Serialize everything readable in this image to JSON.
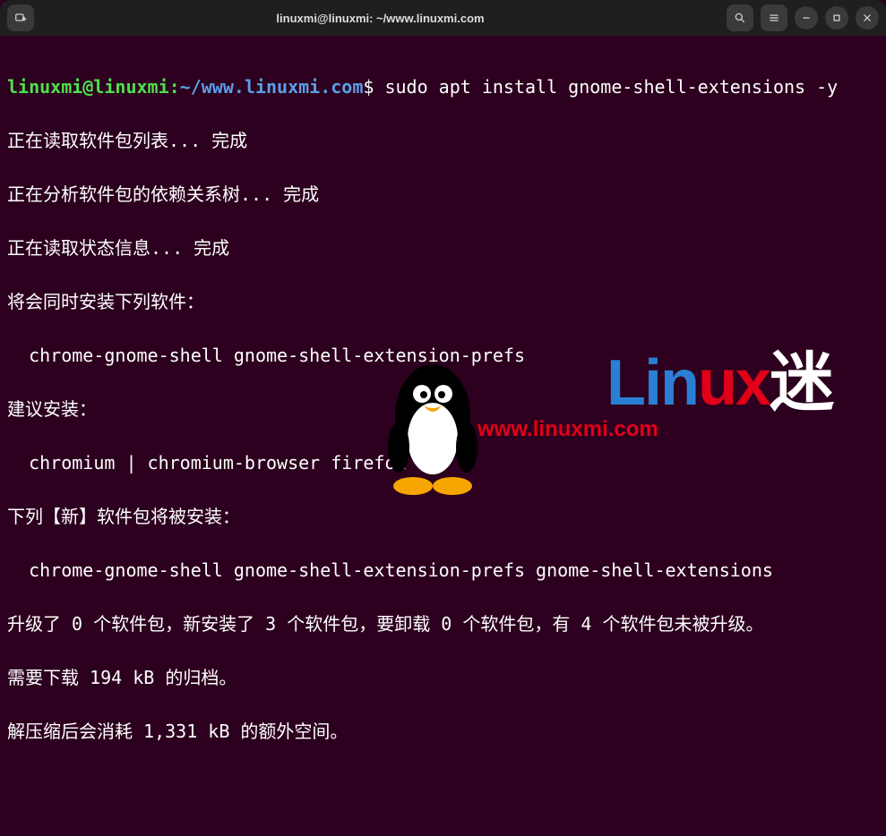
{
  "titlebar": {
    "title": "linuxmi@linuxmi: ~/www.linuxmi.com"
  },
  "prompt": {
    "user_host": "linuxmi@linuxmi",
    "colon": ":",
    "path": "~/www.linuxmi.com",
    "dollar": "$ "
  },
  "command": "sudo apt install gnome-shell-extensions -y",
  "output": {
    "l1": "正在读取软件包列表... 完成",
    "l2": "正在分析软件包的依赖关系树... 完成",
    "l3": "正在读取状态信息... 完成",
    "l4": "将会同时安装下列软件：",
    "l5": "  chrome-gnome-shell gnome-shell-extension-prefs",
    "l6": "建议安装：",
    "l7": "  chromium | chromium-browser firefox",
    "l8": "下列【新】软件包将被安装：",
    "l9": "  chrome-gnome-shell gnome-shell-extension-prefs gnome-shell-extensions",
    "l10": "升级了 0 个软件包，新安装了 3 个软件包，要卸载 0 个软件包，有 4 个软件包未被升级。",
    "l11": "需要下载 194 kB 的归档。",
    "l12": "解压缩后会消耗 1,331 kB 的额外空间。"
  },
  "watermark": {
    "text_part1": "Lin",
    "text_part2": "ux",
    "text_part3": "迷",
    "url": "www.linuxmi.com"
  }
}
